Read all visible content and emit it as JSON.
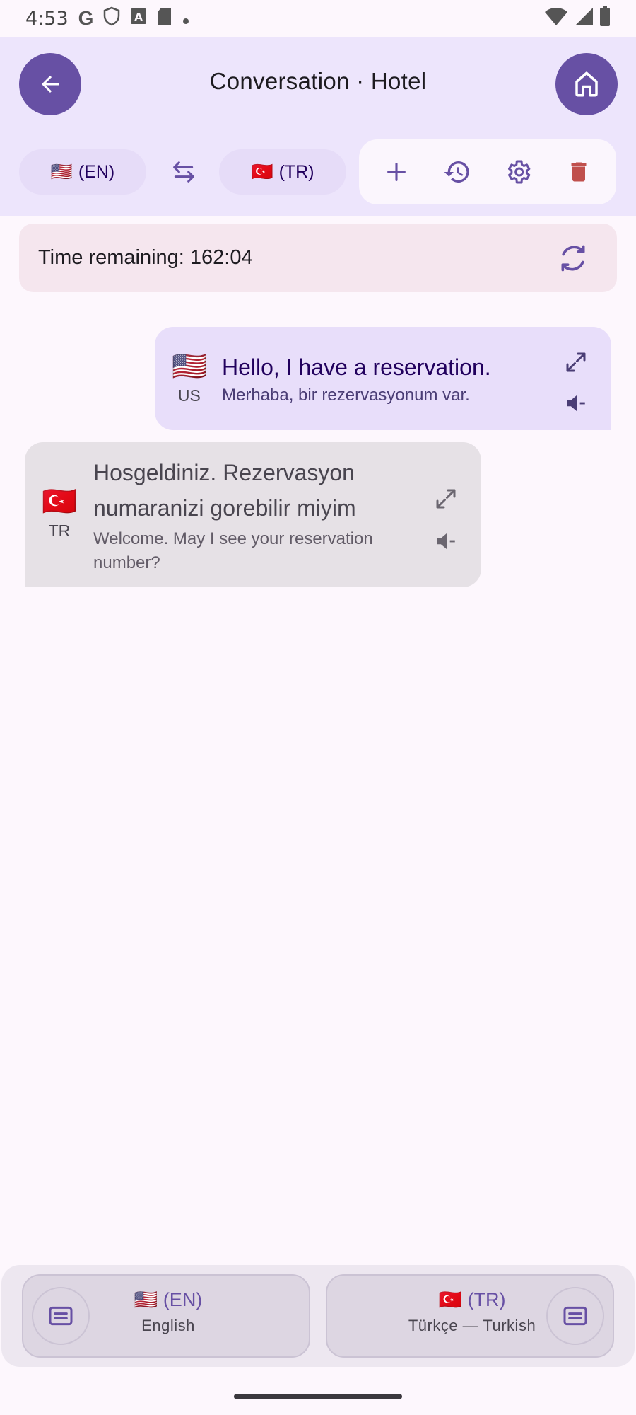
{
  "status_bar": {
    "time": "4:53"
  },
  "header": {
    "title": "Conversation · Hotel",
    "source_lang": {
      "flag": "🇺🇸",
      "code": "(EN)"
    },
    "target_lang": {
      "flag": "🇹🇷",
      "code": "(TR)"
    }
  },
  "timer": {
    "text": "Time remaining: 162:04"
  },
  "messages": [
    {
      "flag": "🇺🇸",
      "code": "US",
      "text": "Hello, I have a reservation.",
      "translation": "Merhaba, bir rezervasyonum var."
    },
    {
      "flag": "🇹🇷",
      "code": "TR",
      "text_line1": "Hosgeldiniz. Rezervasyon",
      "text_line2": "numaranizi gorebilir miyim",
      "translation_line1": "Welcome. May I see your reservation",
      "translation_line2": "number?"
    }
  ],
  "bottom": {
    "left": {
      "flag": "🇺🇸",
      "code": "(EN)",
      "name": "English"
    },
    "right": {
      "flag": "🇹🇷",
      "code": "(TR)",
      "name": "Türkçe — Turkish"
    }
  },
  "colors": {
    "primary": "#6750a4",
    "delete": "#c0504d",
    "appbar_bg": "#ede5fc"
  }
}
